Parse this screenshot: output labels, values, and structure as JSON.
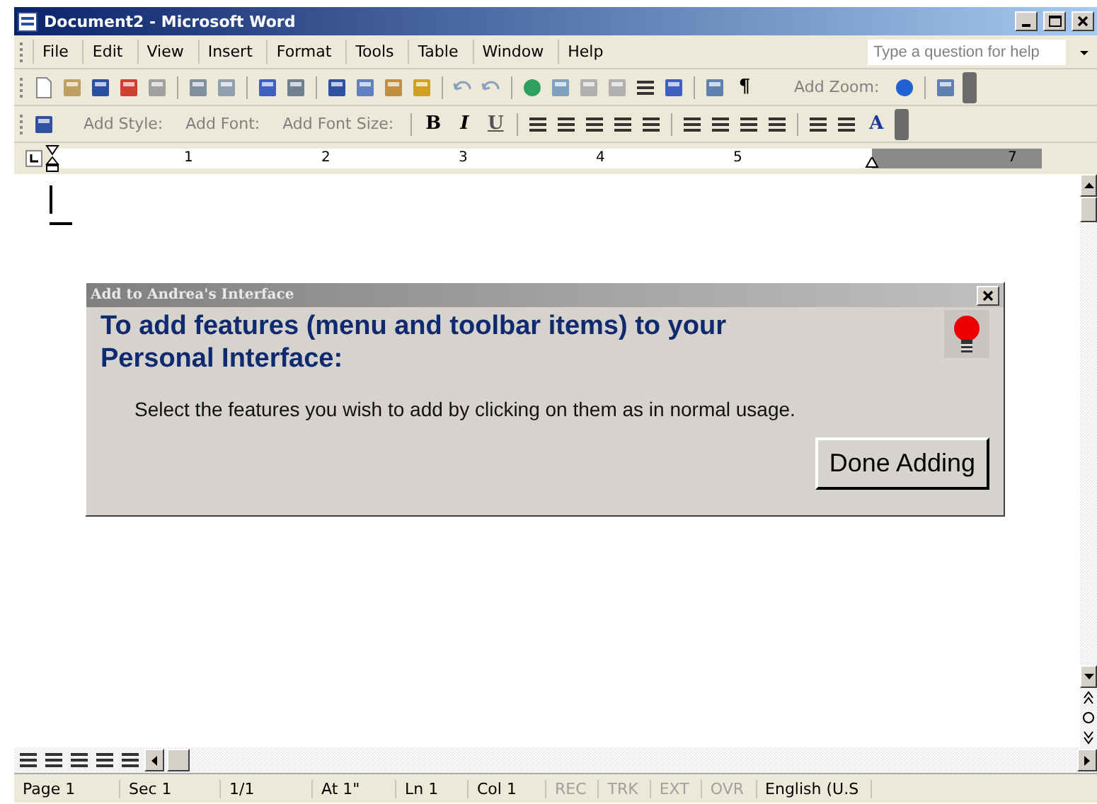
{
  "window": {
    "title": "Document2 - Microsoft Word"
  },
  "menu": [
    {
      "label": "File"
    },
    {
      "label": "Edit"
    },
    {
      "label": "View"
    },
    {
      "label": "Insert"
    },
    {
      "label": "Format"
    },
    {
      "label": "Tools"
    },
    {
      "label": "Table"
    },
    {
      "label": "Window"
    },
    {
      "label": "Help"
    }
  ],
  "help_box": {
    "placeholder": "Type a question for help"
  },
  "standard_toolbar": {
    "paragraph_mark": "¶",
    "add_zoom": "Add Zoom:"
  },
  "formatting_toolbar": {
    "add_style": "Add Style:",
    "add_font": "Add Font:",
    "add_font_size": "Add Font Size:",
    "bold": "B",
    "italic": "I",
    "underline": "U",
    "font_color": "A"
  },
  "ruler": {
    "numbers": [
      "1",
      "2",
      "3",
      "4",
      "5",
      "7"
    ]
  },
  "dialog": {
    "title": "Add to Andrea's Interface",
    "heading": "To add features (menu  and toolbar items) to your Personal Interface:",
    "message": "Select the features you wish to add by clicking on them as in normal usage.",
    "button": "Done Adding"
  },
  "status_bar": [
    {
      "text": "Page 1",
      "disabled": false
    },
    {
      "text": "Sec 1",
      "disabled": false
    },
    {
      "text": "1/1",
      "disabled": false
    },
    {
      "text": "At 1\"",
      "disabled": false
    },
    {
      "text": "Ln 1",
      "disabled": false
    },
    {
      "text": "Col 1",
      "disabled": false
    },
    {
      "text": "REC",
      "disabled": true
    },
    {
      "text": "TRK",
      "disabled": true
    },
    {
      "text": "EXT",
      "disabled": true
    },
    {
      "text": "OVR",
      "disabled": true
    },
    {
      "text": "English (U.S",
      "disabled": false
    }
  ]
}
